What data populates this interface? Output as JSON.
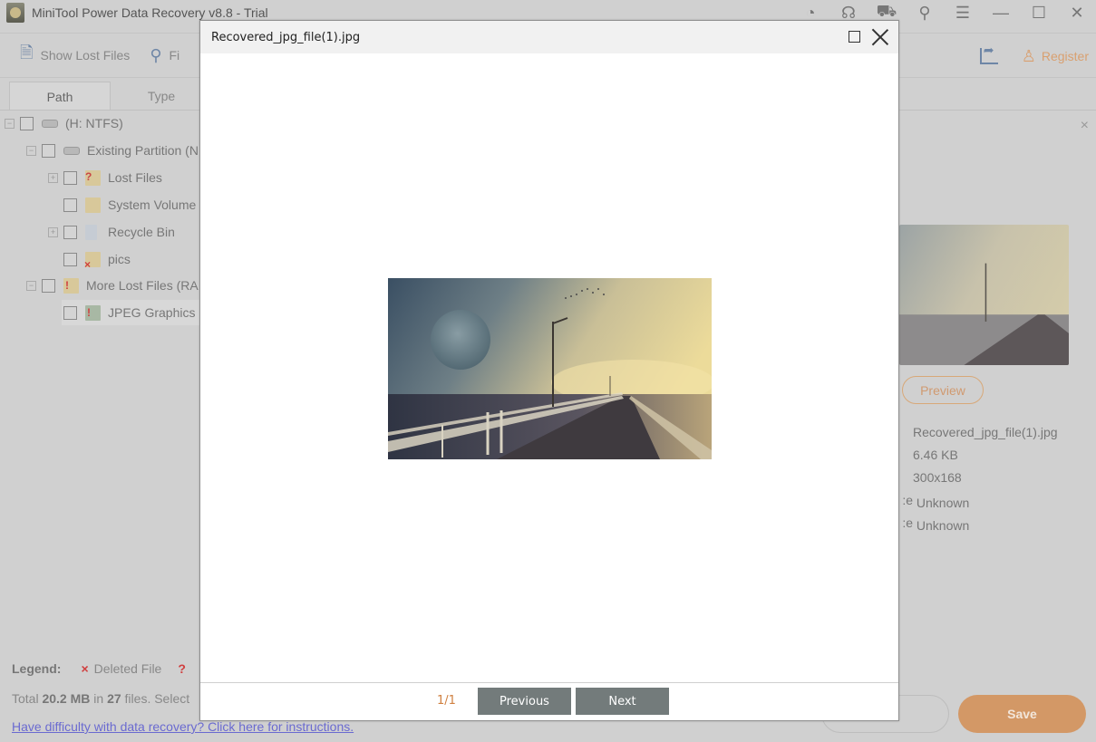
{
  "app": {
    "title": "MiniTool Power Data Recovery v8.8 - Trial",
    "window_controls": [
      "speed-icon",
      "support-icon",
      "cart-icon",
      "key-search-icon",
      "menu-icon",
      "minimize-icon",
      "maximize-icon",
      "close-icon"
    ]
  },
  "toolbar": {
    "show_lost_files": "Show Lost Files",
    "find": "Fi",
    "register": "Register"
  },
  "tabs": [
    {
      "label": "Path",
      "active": true
    },
    {
      "label": "Type",
      "active": false
    }
  ],
  "tree": [
    {
      "label": "(H: NTFS)",
      "level": 0,
      "icon": "drive-icon",
      "expander": "minus"
    },
    {
      "label": "Existing Partition (N",
      "level": 1,
      "icon": "drive-icon",
      "expander": "minus"
    },
    {
      "label": "Lost Files",
      "level": 2,
      "icon": "lost-folder-icon",
      "expander": "plus"
    },
    {
      "label": "System Volume",
      "level": 2,
      "icon": "folder-icon",
      "expander": "none"
    },
    {
      "label": "Recycle Bin",
      "level": 2,
      "icon": "recycle-bin-icon",
      "expander": "plus"
    },
    {
      "label": "pics",
      "level": 2,
      "icon": "deleted-folder-icon",
      "expander": "none"
    },
    {
      "label": "More Lost Files (RA",
      "level": 1,
      "icon": "raw-folder-icon",
      "expander": "minus"
    },
    {
      "label": "JPEG Graphics",
      "level": 2,
      "icon": "jpeg-folder-icon",
      "expander": "none"
    }
  ],
  "details": {
    "preview_label": "Preview",
    "file_name": "Recovered_jpg_file(1).jpg",
    "size": "6.46 KB",
    "dimensions": "300x168",
    "creation_label_tail": "e:",
    "creation_date": "Unknown",
    "modified_label_tail": "e:",
    "modified_date": "Unknown"
  },
  "legend": {
    "label": "Legend:",
    "deleted_file": "Deleted File",
    "deleted_mark": "×",
    "lost_mark": "?"
  },
  "status": {
    "total_prefix": "Total ",
    "total_size": "20.2 MB",
    "in": " in ",
    "file_count": "27",
    "files_suffix": " files.  Select"
  },
  "help_link": "Have difficulty with data recovery? Click here for instructions.",
  "buttons": {
    "save": "Save"
  },
  "viewer": {
    "title": "Recovered_jpg_file(1).jpg",
    "page": "1/1",
    "previous": "Previous",
    "next": "Next"
  },
  "colors": {
    "accent_orange": "#d39866",
    "page_counter": "#d08040",
    "nav_button": "#737b7b",
    "link": "#6a6ad0"
  }
}
